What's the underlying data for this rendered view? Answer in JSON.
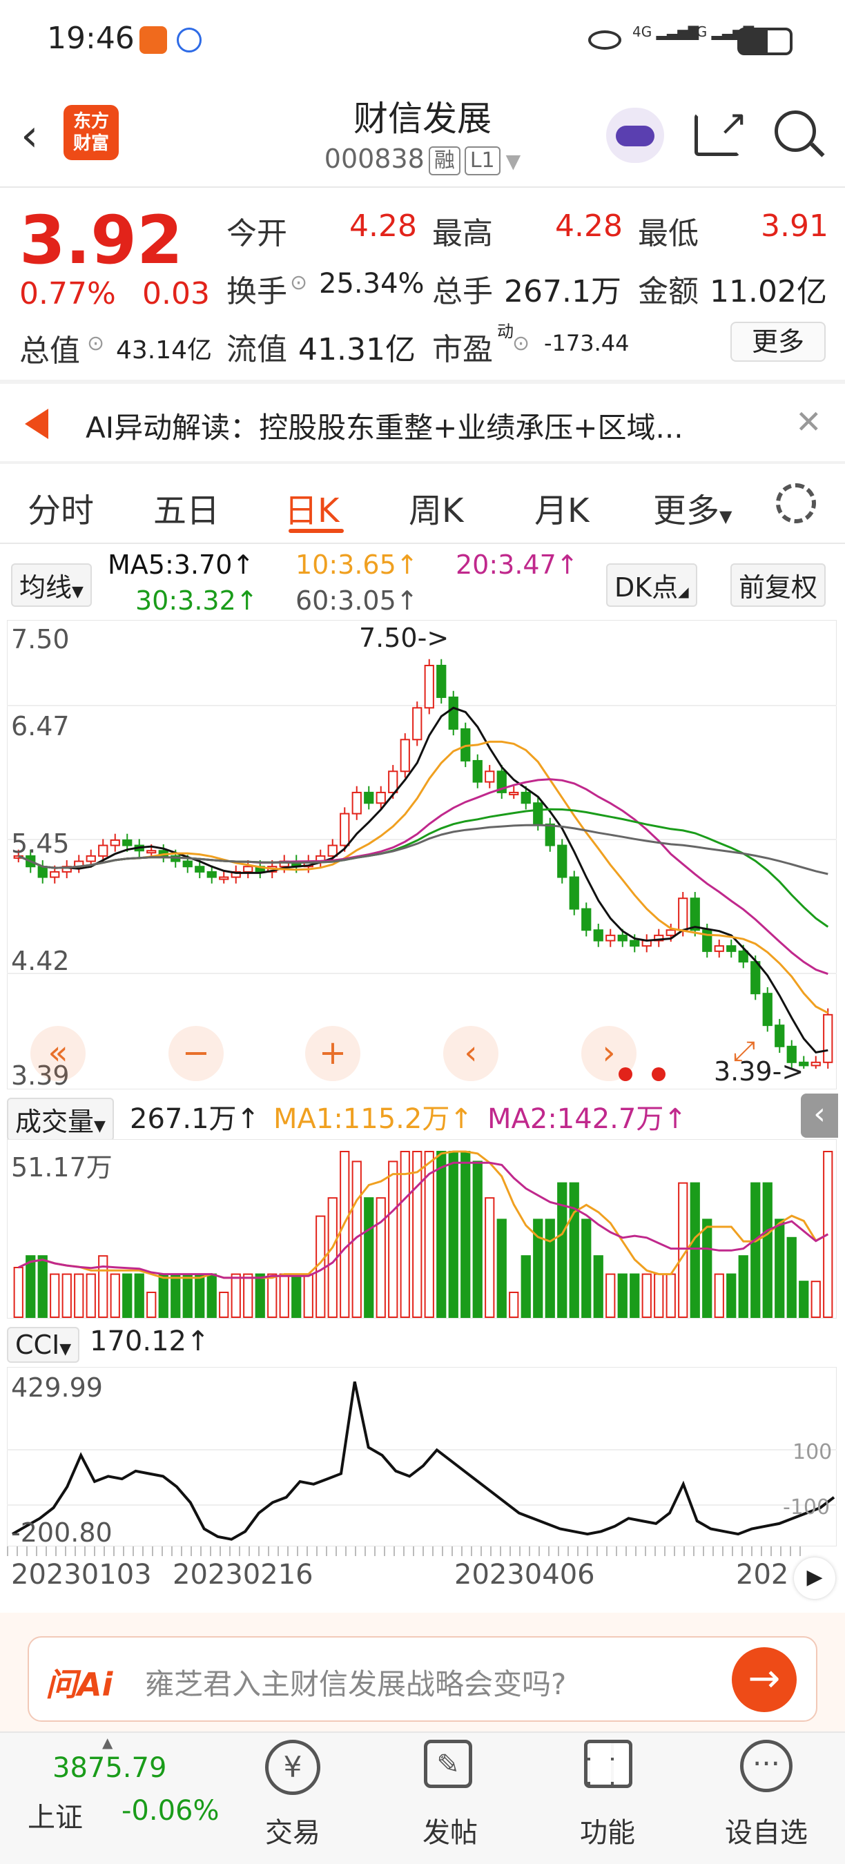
{
  "status": {
    "time": "19:46",
    "net1": "4G",
    "net2": "4G"
  },
  "header": {
    "title": "财信发展",
    "code": "000838",
    "tag1": "融",
    "tag2": "L1",
    "logo_line1": "东方",
    "logo_line2": "财富"
  },
  "quote": {
    "price": "3.92",
    "change_pct": "0.77%",
    "change": "0.03",
    "open_label": "今开",
    "open": "4.28",
    "high_label": "最高",
    "high": "4.28",
    "low_label": "最低",
    "low": "3.91",
    "turnover_label": "换手",
    "turnover": "25.34%",
    "volume_label": "总手",
    "volume": "267.1万",
    "amount_label": "金额",
    "amount": "11.02亿",
    "mktcap_label": "总值",
    "mktcap": "43.14亿",
    "float_label": "流值",
    "float": "41.31亿",
    "pe_label": "市盈",
    "pe_sup": "动",
    "pe": "-173.44",
    "more": "更多"
  },
  "ai_banner": {
    "text": "AI异动解读：控股股东重整+业绩承压+区域..."
  },
  "tabs": [
    "分时",
    "五日",
    "日K",
    "周K",
    "月K",
    "更多"
  ],
  "toolbar": {
    "ma_select": "均线",
    "ma5": "MA5:3.70↑",
    "ma10": "10:3.65↑",
    "ma20": "20:3.47↑",
    "ma30": "30:3.32↑",
    "ma60": "60:3.05↑",
    "dk": "DK点",
    "adjust": "前复权"
  },
  "kline": {
    "y_labels": [
      "7.50",
      "6.47",
      "5.45",
      "4.42",
      "3.39"
    ],
    "high_marker": "7.50->",
    "low_marker": "3.39->"
  },
  "volume_panel": {
    "select": "成交量",
    "value": "267.1万↑",
    "ma1": "MA1:115.2万↑",
    "ma2": "MA2:142.7万↑",
    "y_top": "51.17万"
  },
  "cci_panel": {
    "select": "CCI",
    "value": "170.12↑",
    "y_top": "429.99",
    "y_bottom": "-200.80",
    "ref_high": "100",
    "ref_low": "-100"
  },
  "dates": [
    "20230103",
    "20230216",
    "20230406",
    "202"
  ],
  "ask": {
    "brand": "问Ai",
    "placeholder": "雍芝君入主财信发展战略会变吗?"
  },
  "nav": {
    "index_value": "3875.79",
    "index_name": "上证",
    "index_change": "-0.06%",
    "items": [
      "交易",
      "发帖",
      "功能",
      "设自选"
    ]
  },
  "colors": {
    "up": "#e2231a",
    "down": "#1a9c1a",
    "accent": "#ee4b17",
    "ma5": "#111111",
    "ma10": "#f0a020",
    "ma20": "#c0288c",
    "ma30": "#1a9c1a",
    "ma60": "#666666"
  },
  "chart_data": {
    "type": "line",
    "title": "",
    "closes": [
      5.4,
      5.3,
      5.2,
      5.25,
      5.3,
      5.35,
      5.4,
      5.5,
      5.55,
      5.5,
      5.45,
      5.45,
      5.4,
      5.35,
      5.3,
      5.25,
      5.2,
      5.2,
      5.25,
      5.3,
      5.25,
      5.3,
      5.35,
      5.3,
      5.35,
      5.4,
      5.5,
      5.8,
      6.0,
      5.9,
      6.0,
      6.2,
      6.5,
      6.8,
      7.2,
      6.9,
      6.6,
      6.3,
      6.1,
      6.2,
      6.0,
      6.0,
      5.9,
      5.7,
      5.5,
      5.2,
      4.9,
      4.7,
      4.6,
      4.65,
      4.6,
      4.55,
      4.6,
      4.65,
      4.7,
      5.0,
      4.7,
      4.5,
      4.55,
      4.5,
      4.4,
      4.1,
      3.8,
      3.6,
      3.45,
      3.42,
      3.45,
      3.9
    ],
    "cci": [
      -180,
      -150,
      -120,
      -80,
      0,
      120,
      20,
      40,
      30,
      60,
      50,
      40,
      0,
      -60,
      -160,
      -190,
      -200,
      -170,
      -100,
      -60,
      -40,
      20,
      10,
      30,
      50,
      400,
      150,
      120,
      60,
      40,
      80,
      140,
      100,
      60,
      20,
      -20,
      -60,
      -100,
      -120,
      -140,
      -160,
      -170,
      -180,
      -170,
      -150,
      -120,
      -130,
      -140,
      -100,
      10,
      -130,
      -160,
      -170,
      -180,
      -160,
      -150,
      -140,
      -120,
      -100,
      -80,
      -40
    ]
  }
}
